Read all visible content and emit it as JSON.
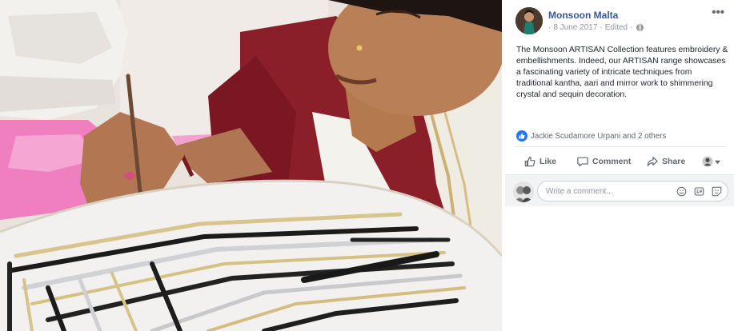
{
  "post": {
    "page_name": "Monsoon Malta",
    "date": "8 June 2017",
    "edited": "Edited",
    "separator": "·",
    "body": "The Monsoon ARTISAN Collection features embroidery & embellishments. Indeed, our ARTISAN range showcases a fascinating variety of intricate techniques from traditional kantha, aari and mirror work to shimmering crystal and sequin decoration.",
    "more_icon": "•••"
  },
  "reactions": {
    "text": "Jackie Scudamore Urpani and 2 others",
    "icon": "like-icon",
    "color": "#2078f4"
  },
  "actions": {
    "like": "Like",
    "comment": "Comment",
    "share": "Share"
  },
  "comment_box": {
    "placeholder": "Write a comment..."
  },
  "colors": {
    "link": "#365899",
    "muted": "#90949c",
    "action": "#606770",
    "comment_bg": "#f2f3f5"
  }
}
